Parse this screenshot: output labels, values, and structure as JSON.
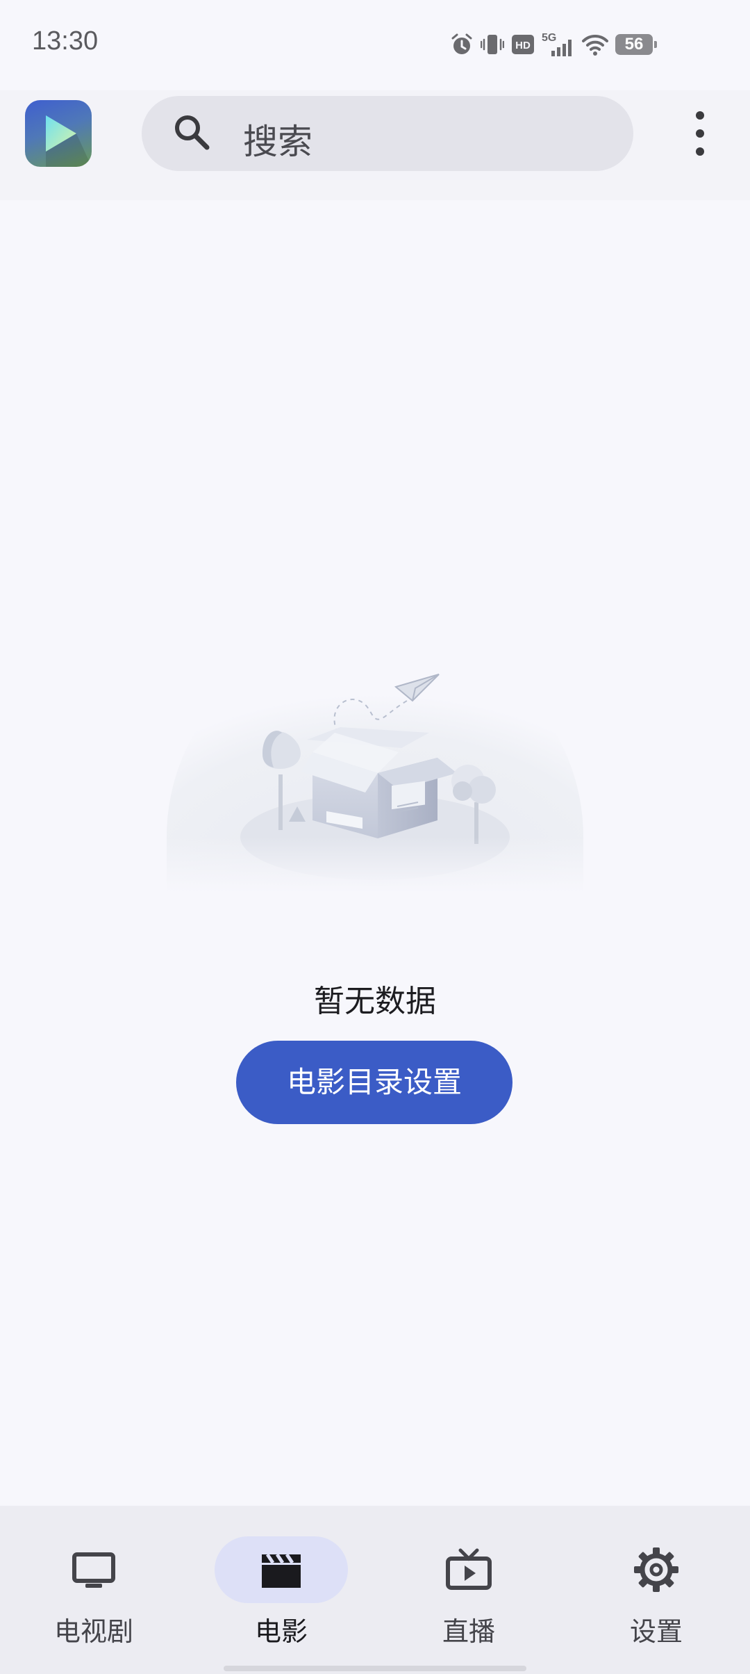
{
  "status_bar": {
    "time": "13:30",
    "network": "5G",
    "battery": "56",
    "icons": [
      "alarm-icon",
      "vibrate-icon",
      "hd-icon",
      "5g-signal-icon",
      "wifi-icon",
      "battery-icon"
    ]
  },
  "top_bar": {
    "logo_icon": "play-logo-icon",
    "search_placeholder": "搜索",
    "more_icon": "more-vertical-icon"
  },
  "empty_state": {
    "illustration": "empty-box-illustration",
    "message": "暂无数据",
    "button_label": "电影目录设置"
  },
  "bottom_nav": {
    "items": [
      {
        "label": "电视剧",
        "icon": "tv-icon",
        "active": false
      },
      {
        "label": "电影",
        "icon": "clapperboard-icon",
        "active": true
      },
      {
        "label": "直播",
        "icon": "live-tv-icon",
        "active": false
      },
      {
        "label": "设置",
        "icon": "gear-icon",
        "active": false
      }
    ]
  },
  "colors": {
    "background": "#f7f7fc",
    "accent": "#3b5cc6",
    "active_pill": "#dde0f7",
    "nav_background": "#ececf2"
  }
}
